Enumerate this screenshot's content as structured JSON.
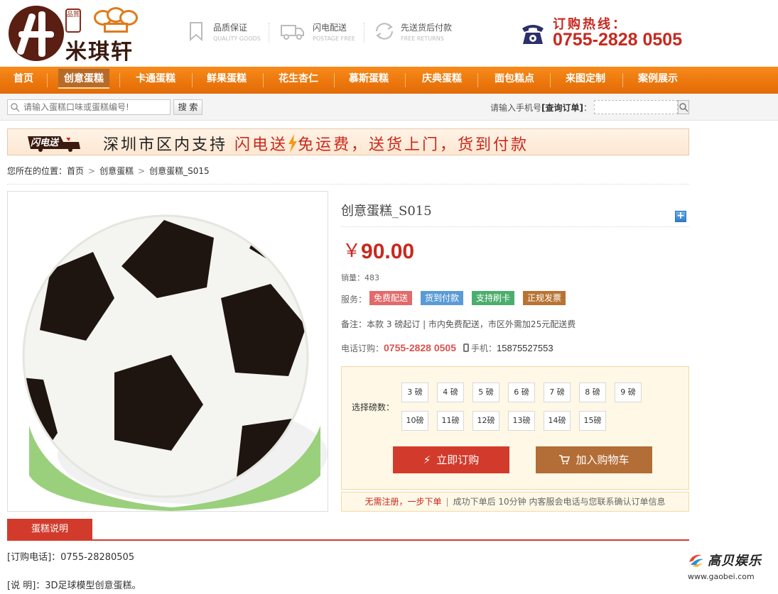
{
  "brand": {
    "name": "米琪轩",
    "seal": "品質"
  },
  "features": [
    {
      "title": "品质保证",
      "sub": "QUALITY GOODS",
      "icon": "bookmark-icon"
    },
    {
      "title": "闪电配送",
      "sub": "POSTAGE FREE",
      "icon": "truck-icon"
    },
    {
      "title": "先送货后付款",
      "sub": "FREE RETURNS",
      "icon": "return-icon"
    }
  ],
  "hotline": {
    "title": "订购热线：",
    "number": "0755-2828 0505",
    "icon": "telephone-icon"
  },
  "nav": [
    {
      "label": "首页",
      "active": false
    },
    {
      "label": "创意蛋糕",
      "active": true
    },
    {
      "label": "卡通蛋糕",
      "active": false
    },
    {
      "label": "鲜果蛋糕",
      "active": false
    },
    {
      "label": "花生杏仁",
      "active": false
    },
    {
      "label": "慕斯蛋糕",
      "active": false
    },
    {
      "label": "庆典蛋糕",
      "active": false
    },
    {
      "label": "面包糕点",
      "active": false
    },
    {
      "label": "来图定制",
      "active": false
    },
    {
      "label": "案例展示",
      "active": false
    }
  ],
  "search": {
    "placeholder": "请输入蛋糕口味或蛋糕编号!",
    "button": "搜 索"
  },
  "order_query": {
    "label_prefix": "请输入手机号",
    "label_bold": "[查询订单]",
    "label_suffix": "："
  },
  "banner": {
    "logo_text": "闪电送",
    "text_prefix": "深圳市区内支持",
    "text_red": "闪电送",
    "text_suffix": "免运费，送货上门，货到付款"
  },
  "breadcrumb": {
    "prefix": "您所在的位置：",
    "items": [
      "首页",
      "创意蛋糕",
      "创意蛋糕_S015"
    ]
  },
  "product": {
    "title": "创意蛋糕_S015",
    "currency": "￥",
    "price": "90.00",
    "sales_label": "销量：",
    "sales": "483",
    "service_label": "服务：",
    "services": [
      {
        "label": "免费配送",
        "color": "#e26a6a"
      },
      {
        "label": "货到付款",
        "color": "#5b9bd5"
      },
      {
        "label": "支持刷卡",
        "color": "#4cae6e"
      },
      {
        "label": "正规发票",
        "color": "#b87333"
      }
    ],
    "note": "备注：本款 3 磅起订 | 市内免费配送，市区外需加25元配送费",
    "tel_label": "电话订购：",
    "tel": "0755-2828 0505",
    "mobile_label": "手机：",
    "mobile": "15875527553",
    "weight_label": "选择磅数：",
    "weights": [
      "3 磅",
      "4 磅",
      "5 磅",
      "6 磅",
      "7 磅",
      "8 磅",
      "9 磅",
      "10磅",
      "11磅",
      "12磅",
      "13磅",
      "14磅",
      "15磅"
    ],
    "buy_label": "立即订购",
    "cart_label": "加入购物车",
    "reg_highlight": "无需注册，一步下单",
    "reg_text": "成功下单后 10分钟 内客服会电话与您联系确认订单信息"
  },
  "description": {
    "tab": "蛋糕说明",
    "line1": "[订购电话]：0755-28280505",
    "line2": "[说 明]：3D足球模型创意蛋糕。"
  },
  "watermark": {
    "text": "高贝娱乐",
    "url": "www.gaobei.com"
  }
}
